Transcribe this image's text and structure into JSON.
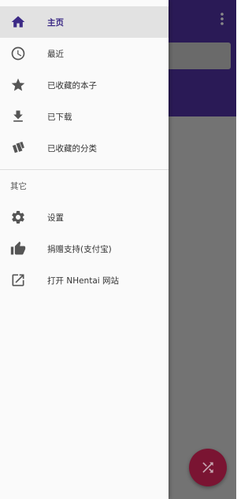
{
  "drawer": {
    "primary_items": [
      {
        "label": "主页",
        "icon": "home-icon",
        "selected": true
      },
      {
        "label": "最近",
        "icon": "clock-icon"
      },
      {
        "label": "已收藏的本子",
        "icon": "star-icon"
      },
      {
        "label": "已下载",
        "icon": "download-icon"
      },
      {
        "label": "已收藏的分类",
        "icon": "tags-icon"
      }
    ],
    "section_title": "其它",
    "other_items": [
      {
        "label": "设置",
        "icon": "gear-icon"
      },
      {
        "label": "捐赠支持(支付宝)",
        "icon": "thumbs-up-icon"
      },
      {
        "label": "打开 NHentai 网站",
        "icon": "open-in-new-icon"
      }
    ]
  },
  "colors": {
    "accent": "#3c2a86",
    "appbar": "#2a1a56",
    "fab": "#7a1432"
  },
  "fab": {
    "icon": "shuffle-icon"
  },
  "appbar": {
    "icon": "more-vert-icon"
  }
}
